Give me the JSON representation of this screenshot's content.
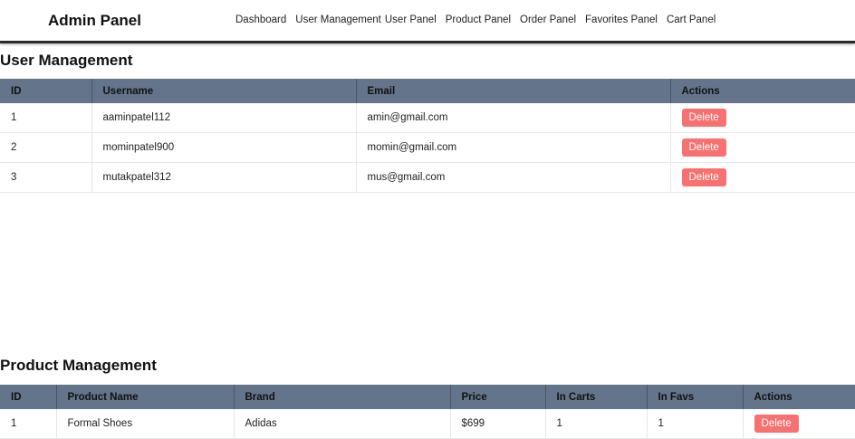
{
  "navbar": {
    "brand": "Admin Panel",
    "links": [
      "Dashboard",
      "User Management",
      "User Panel",
      "Product Panel",
      "Order Panel",
      "Favorites Panel",
      "Cart Panel"
    ],
    "theme_icon": "moon-icon",
    "theme_icon_color": "#7dd3fc"
  },
  "users": {
    "title": "User Management",
    "headers": [
      "ID",
      "Username",
      "Email",
      "Actions"
    ],
    "rows": [
      {
        "id": "1",
        "username": "aaminpatel112",
        "email": "amin@gmail.com",
        "action": "Delete"
      },
      {
        "id": "2",
        "username": "mominpatel900",
        "email": "momin@gmail.com",
        "action": "Delete"
      },
      {
        "id": "3",
        "username": "mutakpatel312",
        "email": "mus@gmail.com",
        "action": "Delete"
      }
    ]
  },
  "products": {
    "title": "Product Management",
    "headers": [
      "ID",
      "Product Name",
      "Brand",
      "Price",
      "In Carts",
      "In Favs",
      "Actions"
    ],
    "rows": [
      {
        "id": "1",
        "name": "Formal Shoes",
        "brand": "Adidas",
        "price": "$699",
        "carts": "1",
        "favs": "1",
        "action": "Delete"
      }
    ]
  },
  "colors": {
    "header_bg": "#64748b",
    "delete_button": "#f87171"
  }
}
